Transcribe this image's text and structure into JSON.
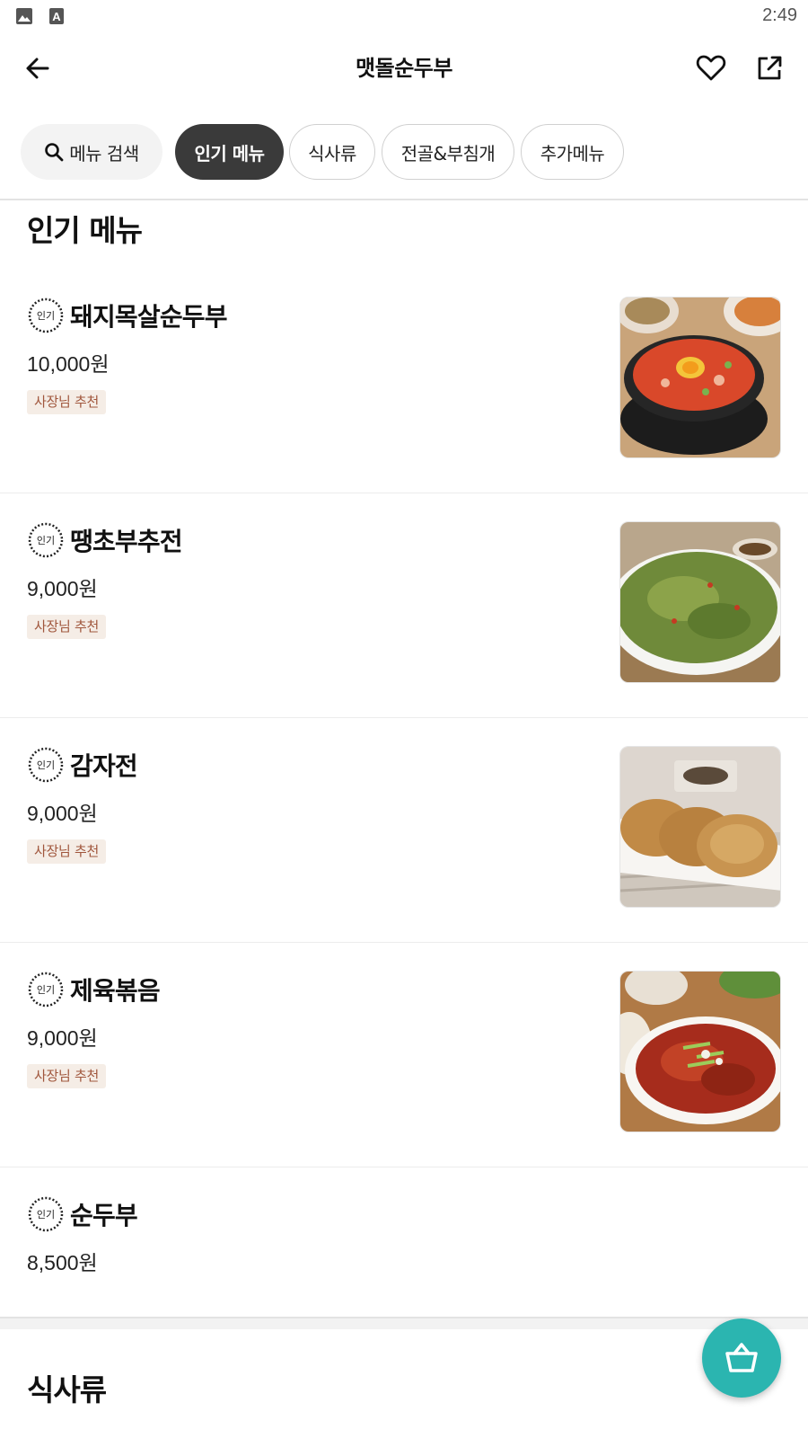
{
  "status_bar": {
    "time": "2:49",
    "icons": [
      "image-icon",
      "a-icon"
    ]
  },
  "header": {
    "title": "맷돌순두부",
    "icons": [
      "back-arrow-icon",
      "heart-icon",
      "share-icon"
    ]
  },
  "tabs": {
    "search_label": "메뉴 검색",
    "items": [
      {
        "label": "인기 메뉴",
        "active": true
      },
      {
        "label": "식사류",
        "active": false
      },
      {
        "label": "전골&부침개",
        "active": false
      },
      {
        "label": "추가메뉴",
        "active": false
      }
    ]
  },
  "sections": [
    {
      "title": "인기 메뉴",
      "items": [
        {
          "badge": "인기",
          "name": "돼지목살순두부",
          "price": "10,000원",
          "tag": "사장님 추천",
          "image": "spicy-tofu-stew-photo"
        },
        {
          "badge": "인기",
          "name": "땡초부추전",
          "price": "9,000원",
          "tag": "사장님 추천",
          "image": "chive-pancake-photo"
        },
        {
          "badge": "인기",
          "name": "감자전",
          "price": "9,000원",
          "tag": "사장님 추천",
          "image": "potato-pancake-photo"
        },
        {
          "badge": "인기",
          "name": "제육볶음",
          "price": "9,000원",
          "tag": "사장님 추천",
          "image": "spicy-pork-photo"
        },
        {
          "badge": "인기",
          "name": "순두부",
          "price": "8,500원"
        }
      ]
    },
    {
      "title": "식사류"
    }
  ],
  "cart_button": {
    "icon": "basket-icon"
  },
  "colors": {
    "accent_teal": "#2bb5b0",
    "active_chip": "#3a3a3a",
    "tag_bg": "#f5ede6",
    "tag_text": "#a0563c"
  }
}
